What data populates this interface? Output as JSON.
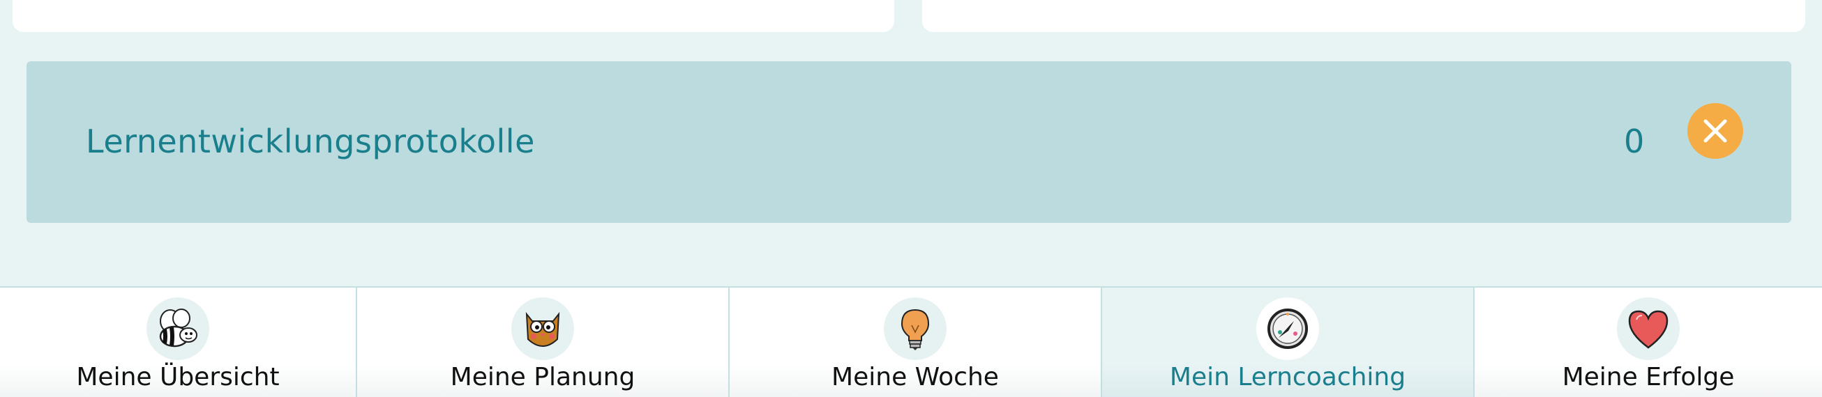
{
  "protocols": {
    "title": "Lernentwicklungsprotokolle",
    "count": "0",
    "close_icon": "close-x-icon"
  },
  "colors": {
    "accent": "#1a7f8c",
    "panel": "#bcdbdf",
    "background": "#e8f3f4",
    "close_button": "#f5ac45"
  },
  "nav": {
    "active_tab": "Mein Lerncoaching",
    "items": [
      {
        "label": "Meine Übersicht",
        "icon": "bee-icon"
      },
      {
        "label": "Meine Planung",
        "icon": "owl-icon"
      },
      {
        "label": "Meine Woche",
        "icon": "lightbulb-icon"
      },
      {
        "label": "Mein Lerncoaching",
        "icon": "compass-icon"
      },
      {
        "label": "Meine Erfolge",
        "icon": "heart-icon"
      }
    ]
  }
}
